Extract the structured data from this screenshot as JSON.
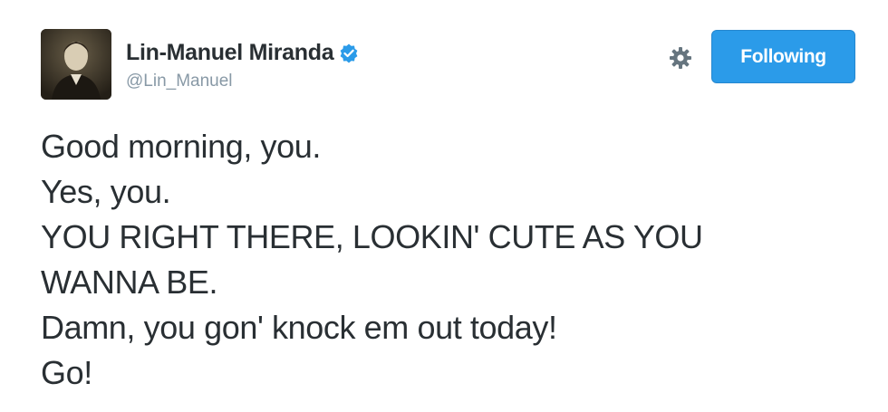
{
  "header": {
    "avatar_icon": "profile-photo",
    "display_name": "Lin-Manuel Miranda",
    "verified_icon": "verified-badge-icon",
    "handle": "@Lin_Manuel",
    "settings_icon": "gear-icon",
    "follow_button_label": "Following"
  },
  "tweet": {
    "lines": [
      "Good morning, you.",
      "Yes, you.",
      "YOU RIGHT THERE, LOOKIN' CUTE AS YOU",
      "WANNA BE.",
      "Damn, you gon' knock em out today!",
      "Go!"
    ]
  },
  "colors": {
    "text": "#292f33",
    "handle": "#8899a6",
    "follow_button_bg": "#2b9be9",
    "verified": "#2b9be9"
  }
}
